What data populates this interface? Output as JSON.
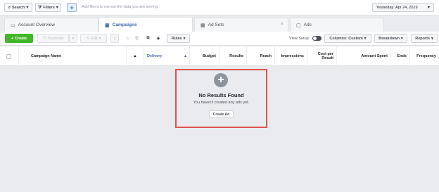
{
  "filterbar": {
    "search_label": "Search",
    "filters_label": "Filters",
    "add_label": "+",
    "hint": "Add filters to narrow the data you are seeing.",
    "date_label": "Yesterday: Apr 24, 2019"
  },
  "tabs": [
    {
      "label": "Account Overview",
      "icon": "overview-icon"
    },
    {
      "label": "Campaigns",
      "icon": "campaigns-icon"
    },
    {
      "label": "Ad Sets",
      "icon": "adsets-icon"
    },
    {
      "label": "Ads",
      "icon": "ads-icon"
    }
  ],
  "toolbar": {
    "create_label": "Create",
    "duplicate_label": "Duplicate",
    "edit_label": "Edit",
    "rules_label": "Rules",
    "view_setup_label": "View Setup",
    "columns_label": "Columns: Custom",
    "breakdown_label": "Breakdown",
    "reports_label": "Reports"
  },
  "table": {
    "headers": {
      "campaign_name": "Campaign Name",
      "delivery": "Delivery",
      "budget": "Budget",
      "results": "Results",
      "reach": "Reach",
      "impressions": "Impressions",
      "cost_per_result": "Cost per Result",
      "amount_spent": "Amount Spent",
      "ends": "Ends",
      "frequency": "Frequency"
    }
  },
  "empty_state": {
    "title": "No Results Found",
    "subtitle": "You haven't created any ads yet.",
    "button": "Create Ad"
  },
  "colors": {
    "accent": "#4267b2",
    "create_green": "#42b72a",
    "highlight_red": "#e0524e"
  }
}
